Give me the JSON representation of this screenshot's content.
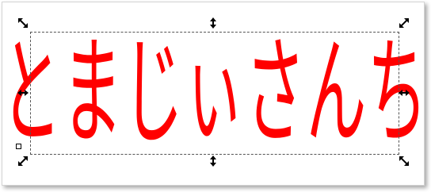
{
  "canvas": {
    "text_object": {
      "text": "とまじぃさんち",
      "fill_color": "#ff0000"
    }
  },
  "selection": {
    "handle_icon": "scale-arrow-icon",
    "rotation_center_icon": "rotation-center-icon"
  }
}
